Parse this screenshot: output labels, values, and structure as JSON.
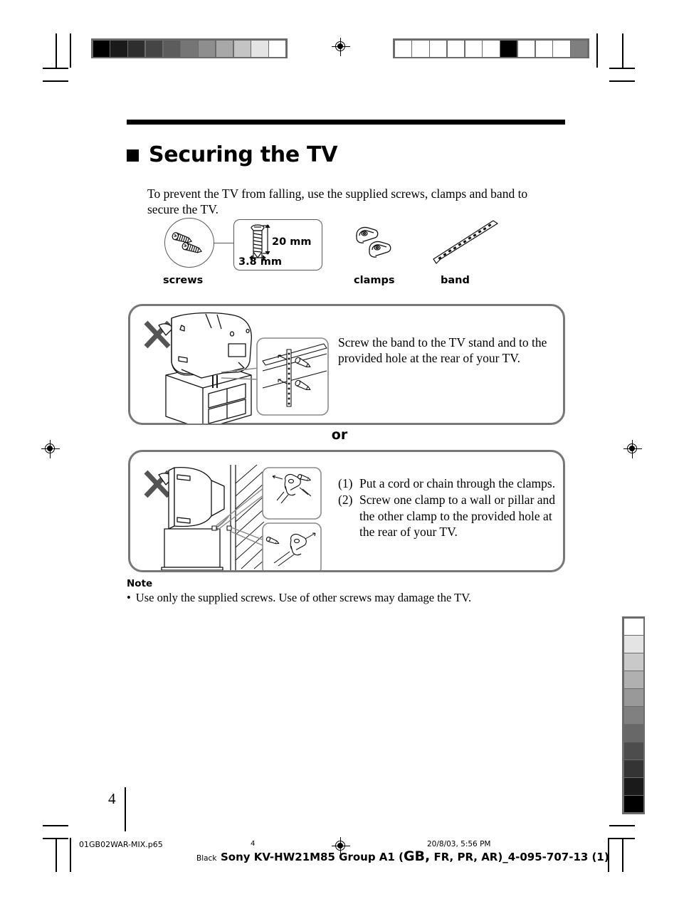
{
  "document": {
    "title": "Securing the TV",
    "intro": "To prevent the TV from falling, use the supplied  screws, clamps and band to secure the TV."
  },
  "parts": {
    "screws": {
      "caption": "screws",
      "spec_length": "20 mm",
      "spec_diameter": "3.8 mm"
    },
    "clamps": {
      "caption": "clamps"
    },
    "band": {
      "caption": "band"
    }
  },
  "methods": {
    "band_method": {
      "instruction": "Screw the band to the TV stand and to the provided hole at the rear of your TV."
    },
    "separator": "or",
    "clamp_method": {
      "steps": [
        {
          "num": "(1)",
          "text": "Put a cord or chain through the clamps."
        },
        {
          "num": "(2)",
          "text": "Screw one clamp to a wall or pillar and the other clamp to the provided hole at the rear of your TV."
        }
      ]
    }
  },
  "note": {
    "heading": "Note",
    "bullet": "•",
    "text": "Use only the supplied screws.  Use of other screws may damage the TV."
  },
  "page": {
    "number": "4"
  },
  "footer": {
    "file_name": "01GB02WAR-MIX.p65",
    "page_number": "4",
    "timestamp": "20/8/03, 5:56 PM",
    "plate": "Black",
    "job_title_prefix": "Sony KV-HW21M85 Group A1 (",
    "job_title_emphasis": "GB,",
    "job_title_suffix": " FR, PR, AR)_4-095-707-13 (1)"
  },
  "prepress": {
    "wedge_top_left": [
      "#000000",
      "#1a1a1a",
      "#2e2e2e",
      "#454545",
      "#5c5c5c",
      "#757575",
      "#8e8e8e",
      "#a8a8a8",
      "#c4c4c4",
      "#e4e4e4",
      "#ffffff"
    ],
    "wedge_top_right": [
      "#ffffff",
      "#ffffff",
      "#ffffff",
      "#ffffff",
      "#ffffff",
      "#ffffff",
      "#000000",
      "#ffffff",
      "#ffffff",
      "#ffffff",
      "#7f7f7f"
    ],
    "wedge_right_vertical": [
      "#ffffff",
      "#e4e4e4",
      "#c9c9c9",
      "#b0b0b0",
      "#999999",
      "#808080",
      "#686868",
      "#4d4d4d",
      "#343434",
      "#1a1a1a",
      "#000000"
    ]
  }
}
